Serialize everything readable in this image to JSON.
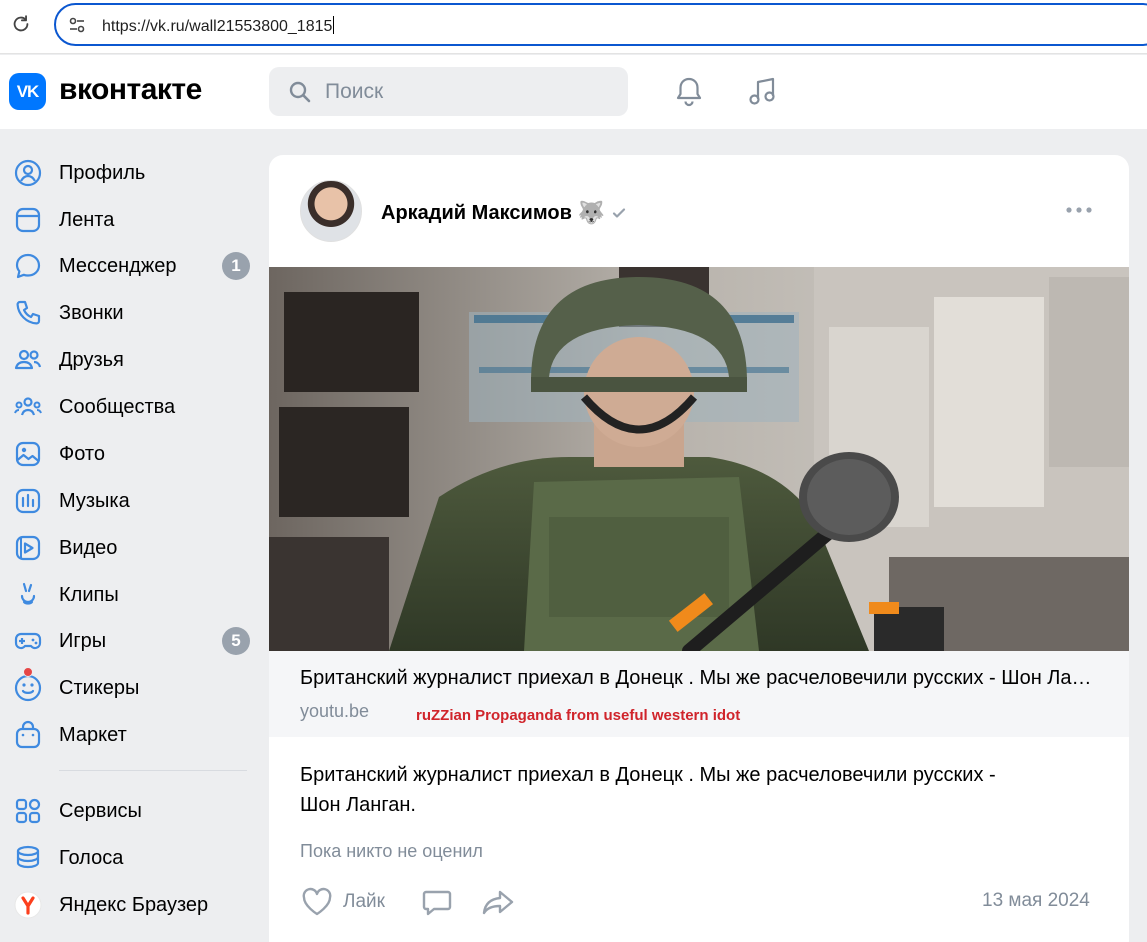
{
  "browser": {
    "url": "https://vk.ru/wall21553800_1815",
    "reload_icon": "reload-icon",
    "site_info_icon": "tune-icon"
  },
  "header": {
    "logo_text": "VK",
    "wordmark": "вконтакте",
    "search_placeholder": "Поиск",
    "brand_color": "#0077ff"
  },
  "sidebar": {
    "items": [
      {
        "label": "Профиль",
        "icon": "profile-icon"
      },
      {
        "label": "Лента",
        "icon": "feed-icon"
      },
      {
        "label": "Мессенджер",
        "icon": "messenger-icon",
        "badge": "1"
      },
      {
        "label": "Звонки",
        "icon": "phone-icon"
      },
      {
        "label": "Друзья",
        "icon": "friends-icon"
      },
      {
        "label": "Сообщества",
        "icon": "communities-icon"
      },
      {
        "label": "Фото",
        "icon": "photo-icon"
      },
      {
        "label": "Музыка",
        "icon": "music-icon"
      },
      {
        "label": "Видео",
        "icon": "video-icon"
      },
      {
        "label": "Клипы",
        "icon": "clips-icon"
      },
      {
        "label": "Игры",
        "icon": "games-icon",
        "badge": "5"
      },
      {
        "label": "Стикеры",
        "icon": "stickers-icon"
      },
      {
        "label": "Маркет",
        "icon": "market-icon"
      },
      {
        "label": "Сервисы",
        "icon": "services-icon"
      },
      {
        "label": "Голоса",
        "icon": "votes-icon"
      },
      {
        "label": "Яндекс Браузер",
        "icon": "yandex-browser-icon"
      }
    ]
  },
  "post": {
    "author": "Аркадий Максимов",
    "author_emoji": "🐺",
    "link_title": "Британский журналист приехал в Донецк . Мы же расчеловечили русских - Шон Ланган.",
    "link_domain": "youtu.be",
    "overlay_caption": "ruZZian Propaganda from useful western idot",
    "text_line1": "Британский журналист приехал в Донецк . Мы же расчеловечили русских -",
    "text_line2": "Шон Ланган.",
    "likes_text": "Пока никто не оценил",
    "like_label": "Лайк",
    "date": "13 мая 2024"
  }
}
